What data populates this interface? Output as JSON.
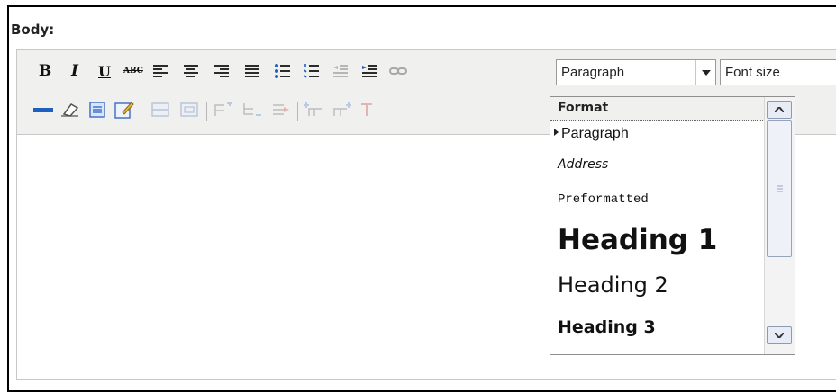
{
  "field": {
    "label": "Body:"
  },
  "toolbar": {
    "bold_label": "B",
    "italic_label": "I",
    "underline_label": "U",
    "strikethrough_label": "ABC",
    "format_select": {
      "value": "Paragraph"
    },
    "fontsize_select": {
      "value": "Font size"
    }
  },
  "format_dropdown": {
    "header": "Format",
    "selected": "Paragraph",
    "items": [
      {
        "label": "Paragraph"
      },
      {
        "label": "Address"
      },
      {
        "label": "Preformatted"
      },
      {
        "label": "Heading 1"
      },
      {
        "label": "Heading 2"
      },
      {
        "label": "Heading 3"
      }
    ]
  },
  "colors": {
    "toolbar_bg": "#f0f0ee",
    "border": "#c8c8c8",
    "list_number_blue": "#1f5fbf",
    "link_gray": "#a8a8a8"
  }
}
